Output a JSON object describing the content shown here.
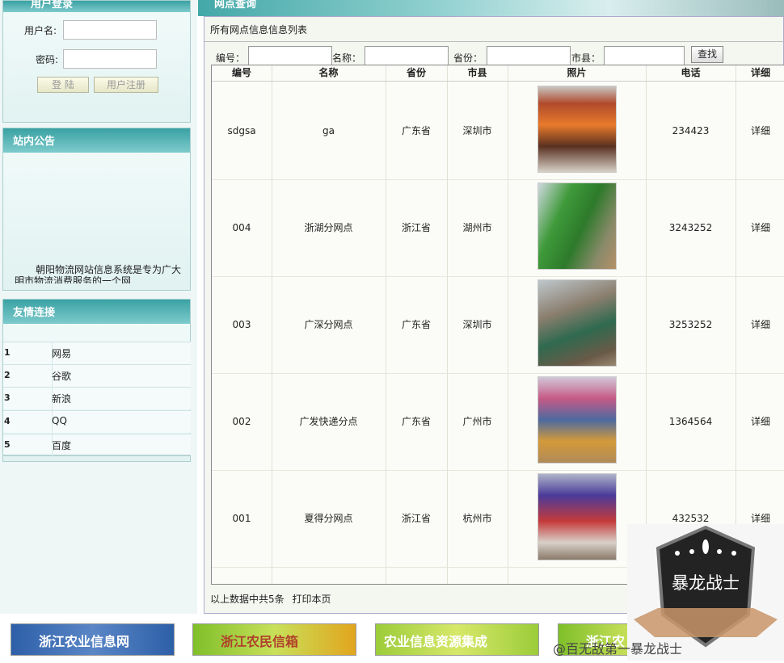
{
  "sidebar": {
    "login": {
      "title": "用户登录",
      "username_label": "用户名:",
      "password_label": "密码:",
      "username_value": "",
      "password_value": "",
      "login_button": "登 陆",
      "register_button": "用户注册"
    },
    "notice": {
      "title": "站内公告",
      "text": "朝阳物流网站信息系统是专为广大明市物流消费服务的一个网"
    },
    "links": {
      "title": "友情连接",
      "items": [
        {
          "num": "1",
          "label": "网易"
        },
        {
          "num": "2",
          "label": "谷歌"
        },
        {
          "num": "3",
          "label": "新浪"
        },
        {
          "num": "4",
          "label": "QQ"
        },
        {
          "num": "5",
          "label": "百度"
        }
      ]
    }
  },
  "main": {
    "banner_title": "网点查询",
    "subtitle": "所有网点信息信息列表",
    "search": {
      "id_label": "编号：",
      "name_label": "名称：",
      "province_label": "省份：",
      "city_label": "市县：",
      "button": "查找"
    },
    "table": {
      "headers": [
        "编号",
        "名称",
        "省份",
        "市县",
        "照片",
        "电话",
        "详细"
      ],
      "rows": [
        {
          "id": "sdgsa",
          "name": "ga",
          "province": "广东省",
          "city": "深圳市",
          "phone": "234423",
          "detail": "详细"
        },
        {
          "id": "004",
          "name": "浙湖分网点",
          "province": "浙江省",
          "city": "湖州市",
          "phone": "3243252",
          "detail": "详细"
        },
        {
          "id": "003",
          "name": "广深分网点",
          "province": "广东省",
          "city": "深圳市",
          "phone": "3253252",
          "detail": "详细"
        },
        {
          "id": "002",
          "name": "广发快递分点",
          "province": "广东省",
          "city": "广州市",
          "phone": "1364564",
          "detail": "详细"
        },
        {
          "id": "001",
          "name": "夏得分网点",
          "province": "浙江省",
          "city": "杭州市",
          "phone": "432532",
          "detail": "详细"
        }
      ]
    },
    "footer_count": "以上数据中共5条",
    "print_link": "打印本页"
  },
  "bottom_logos": [
    "浙江农业信息网",
    "浙江农民信箱",
    "农业信息资源集成",
    "浙江农"
  ],
  "watermark": {
    "badge": "暴龙战士",
    "credit": "@百无敌第一暴龙战士"
  }
}
